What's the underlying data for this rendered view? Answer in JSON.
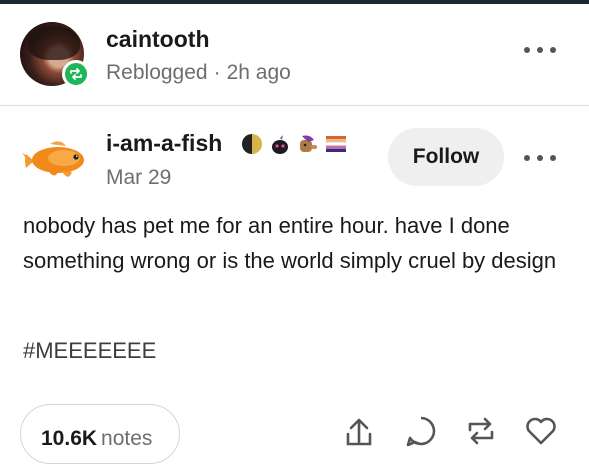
{
  "reblog": {
    "username": "caintooth",
    "action": "Reblogged",
    "time": "2h ago",
    "separator": "·"
  },
  "post": {
    "author": "i-am-a-fish",
    "date": "Mar 29",
    "follow_label": "Follow",
    "badges": [
      "moon-badge-icon",
      "ghost-badge-icon",
      "pony-badge-icon",
      "flag-badge-icon"
    ],
    "body": "nobody has pet me for an entire hour.  have I done something wrong or is the world simply cruel by design",
    "tag": "#MEEEEEEE"
  },
  "footer": {
    "notes_count": "10.6K",
    "notes_label": "notes",
    "actions": [
      "share-icon",
      "reply-icon",
      "reblog-icon",
      "like-icon"
    ]
  },
  "colors": {
    "reblog_green": "#1fb55a",
    "muted_text": "#6e6e6e",
    "follow_bg": "#efefef"
  }
}
